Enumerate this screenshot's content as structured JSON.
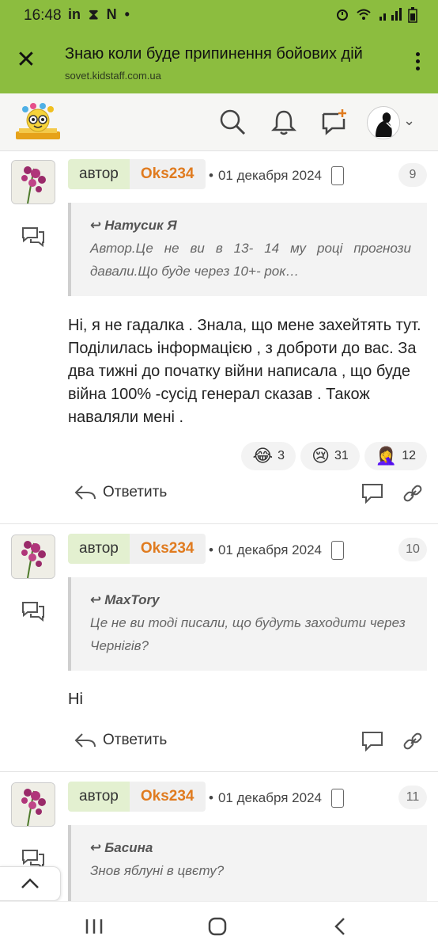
{
  "status": {
    "time": "16:48",
    "left_icons": [
      "linkedin-icon",
      "hourglass-icon",
      "n-app-icon",
      "dot-icon"
    ],
    "right_icons": [
      "alarm-icon",
      "wifi-icon",
      "signal-icon",
      "battery-icon"
    ],
    "left_glyphs": [
      "in",
      "⧗",
      "N",
      "•"
    ]
  },
  "app_bar": {
    "title": "Знаю коли буде припинення бойових дій",
    "url": "sovet.kidstaff.com.ua"
  },
  "colors": {
    "brand_green": "#8cbd3f",
    "nick_orange": "#e07b1f",
    "role_bg": "#e3f0d0"
  },
  "posts": [
    {
      "role": "автор",
      "nick": "Oks234",
      "date": "01 декабря 2024",
      "number": "9",
      "quote_author": "Натусик Я",
      "quote_text": "Автор.Це не ви в 13- 14 му році прогнози давали.Що буде через 10+- рок…",
      "body": "Ні, я не гадалка . Знала, що мене захейтять тут. Поділилась інформацією , з доброти до вас. За два тижні до початку війни написала , що буде війна 100% -сусід генерал сказав . Також наваляли мені .",
      "reactions": [
        {
          "emoji": "😂",
          "count": "3"
        },
        {
          "emoji": "😢",
          "count": "31"
        },
        {
          "emoji": "🤦‍♀️",
          "count": "12"
        }
      ],
      "reply_label": "Ответить"
    },
    {
      "role": "автор",
      "nick": "Oks234",
      "date": "01 декабря 2024",
      "number": "10",
      "quote_author": "MaxTory",
      "quote_text": "Це не ви тоді писали, що будуть заходити через Чернігів?",
      "body": "Ні",
      "reply_label": "Ответить"
    },
    {
      "role": "автор",
      "nick": "Oks234",
      "date": "01 декабря 2024",
      "number": "11",
      "quote_author": "Басина",
      "quote_text": "Знов яблуні в цвєту?"
    }
  ]
}
